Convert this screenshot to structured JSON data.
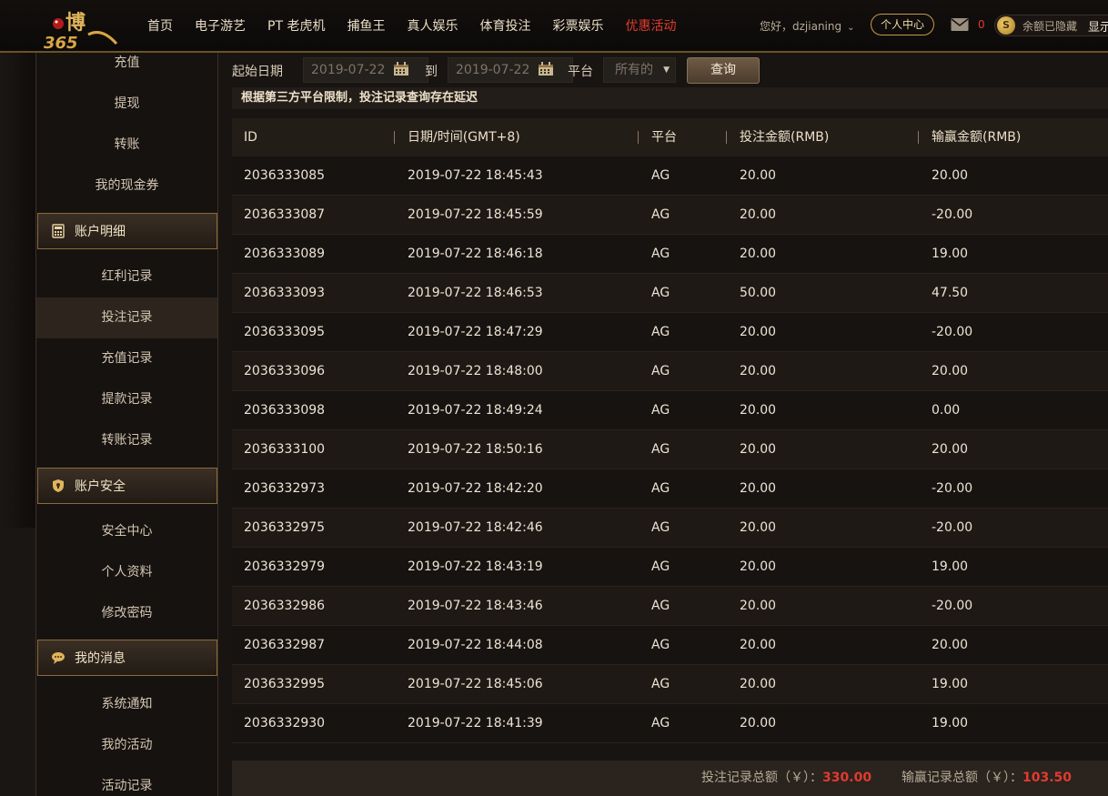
{
  "header": {
    "logo_text": "博 365",
    "nav": [
      "首页",
      "电子游艺",
      "PT 老虎机",
      "捕鱼王",
      "真人娱乐",
      "体育投注",
      "彩票娱乐",
      "优惠活动"
    ],
    "greeting": "您好，dzjianing",
    "personal_center": "个人中心",
    "mail_count": "0",
    "balance_text": "余额已隐藏",
    "balance_show": "显示"
  },
  "sidebar": {
    "top_items": [
      "充值",
      "提现",
      "转账",
      "我的现金券"
    ],
    "sections": [
      {
        "title": "账户明细",
        "items": [
          "红利记录",
          "投注记录",
          "充值记录",
          "提款记录",
          "转账记录"
        ]
      },
      {
        "title": "账户安全",
        "items": [
          "安全中心",
          "个人资料",
          "修改密码"
        ]
      },
      {
        "title": "我的消息",
        "items": [
          "系统通知",
          "我的活动",
          "活动记录"
        ]
      }
    ],
    "active_item": "投注记录"
  },
  "filter": {
    "start_label": "起始日期",
    "start_date": "2019-07-22",
    "to_label": "到",
    "end_date": "2019-07-22",
    "platform_label": "平台",
    "platform_value": "所有的",
    "query_button": "查询"
  },
  "notice": "根据第三方平台限制，投注记录查询存在延迟",
  "table": {
    "columns": [
      "ID",
      "日期/时间(GMT+8)",
      "平台",
      "投注金额(RMB)",
      "输赢金额(RMB)"
    ],
    "rows": [
      [
        "2036333085",
        "2019-07-22 18:45:43",
        "AG",
        "20.00",
        "20.00"
      ],
      [
        "2036333087",
        "2019-07-22 18:45:59",
        "AG",
        "20.00",
        "-20.00"
      ],
      [
        "2036333089",
        "2019-07-22 18:46:18",
        "AG",
        "20.00",
        "19.00"
      ],
      [
        "2036333093",
        "2019-07-22 18:46:53",
        "AG",
        "50.00",
        "47.50"
      ],
      [
        "2036333095",
        "2019-07-22 18:47:29",
        "AG",
        "20.00",
        "-20.00"
      ],
      [
        "2036333096",
        "2019-07-22 18:48:00",
        "AG",
        "20.00",
        "20.00"
      ],
      [
        "2036333098",
        "2019-07-22 18:49:24",
        "AG",
        "20.00",
        "0.00"
      ],
      [
        "2036333100",
        "2019-07-22 18:50:16",
        "AG",
        "20.00",
        "20.00"
      ],
      [
        "2036332973",
        "2019-07-22 18:42:20",
        "AG",
        "20.00",
        "-20.00"
      ],
      [
        "2036332975",
        "2019-07-22 18:42:46",
        "AG",
        "20.00",
        "-20.00"
      ],
      [
        "2036332979",
        "2019-07-22 18:43:19",
        "AG",
        "20.00",
        "19.00"
      ],
      [
        "2036332986",
        "2019-07-22 18:43:46",
        "AG",
        "20.00",
        "-20.00"
      ],
      [
        "2036332987",
        "2019-07-22 18:44:08",
        "AG",
        "20.00",
        "20.00"
      ],
      [
        "2036332995",
        "2019-07-22 18:45:06",
        "AG",
        "20.00",
        "19.00"
      ],
      [
        "2036332930",
        "2019-07-22 18:41:39",
        "AG",
        "20.00",
        "19.00"
      ]
    ]
  },
  "summary": {
    "bet_label": "投注记录总额（￥）：",
    "bet_total": "330.00",
    "win_label": "输赢记录总额（￥）：",
    "win_total": "103.50"
  },
  "colors": {
    "accent_gold": "#c49a4a",
    "promo_red": "#e23b2e",
    "background": "#141110"
  }
}
